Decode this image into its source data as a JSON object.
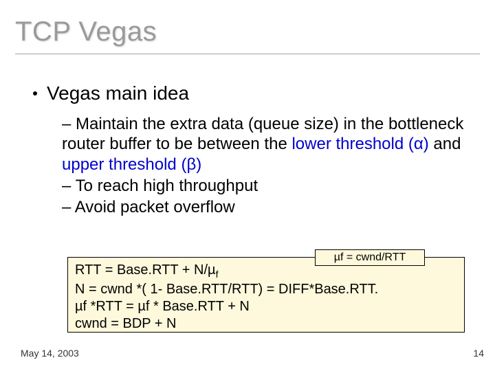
{
  "title": "TCP Vegas",
  "main_bullet": "Vegas main idea",
  "sub": {
    "line1_pre": "– Maintain the extra data (queue size) in the bottleneck router buffer to be between the ",
    "lower_label": "lower threshold (α)",
    "mid": " and ",
    "upper_label": "upper threshold (β)",
    "line2": "– To reach high throughput",
    "line3": "– Avoid packet overflow"
  },
  "callout": "µf  = cwnd/RTT",
  "formula": {
    "l1_a": "RTT = Base.RTT + N/µ",
    "l1_sub": "f",
    "l2": "N = cwnd *( 1- Base.RTT/RTT) = DIFF*Base.RTT.",
    "l3": "µf *RTT = µf * Base.RTT + N",
    "l4": "cwnd = BDP + N"
  },
  "footer_date": "May 14, 2003",
  "page_number": "14"
}
